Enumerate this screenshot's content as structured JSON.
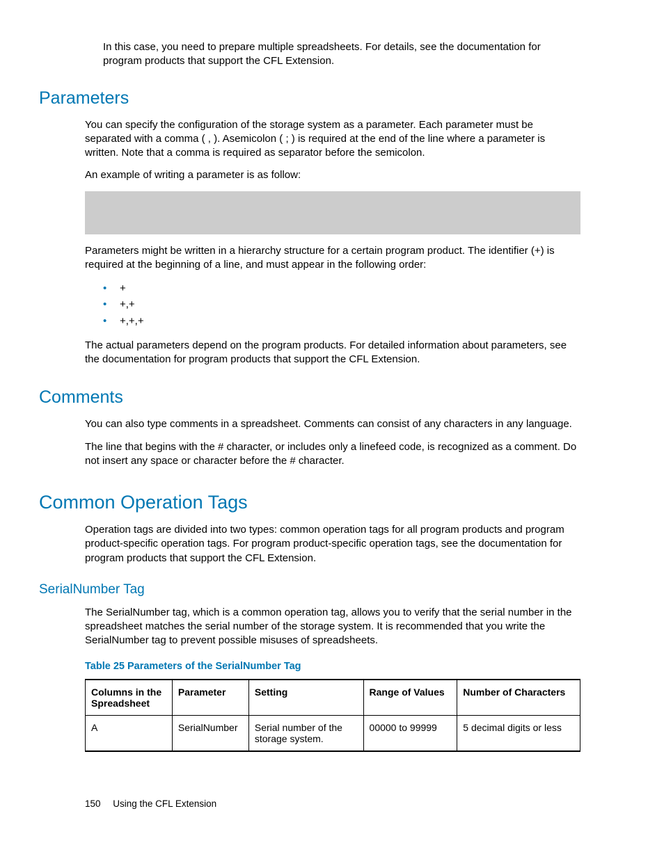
{
  "intro": "In this case, you need to prepare multiple spreadsheets. For details, see the documentation for program products that support the CFL Extension.",
  "parameters": {
    "heading": "Parameters",
    "p1": "You can specify the configuration of the storage system as a parameter. Each parameter must be separated with a comma ( , ). Asemicolon ( ; ) is required at the end of the line where a parameter is written. Note that a comma is required as separator before the semicolon.",
    "p2": "An example of writing a parameter is as follow:",
    "p3": "Parameters might be written in a hierarchy structure for a certain program product. The identifier (+) is required at the beginning of a line, and must appear in the following order:",
    "bullets": [
      "+",
      "+,+",
      "+,+,+"
    ],
    "p4": "The actual parameters depend on the program products. For detailed information about parameters, see the documentation for program products that support the CFL Extension."
  },
  "comments": {
    "heading": "Comments",
    "p1": "You can also type comments in a spreadsheet. Comments can consist of any characters in any language.",
    "p2": "The line that begins with the # character, or includes only a linefeed code, is recognized as a comment. Do not insert any space or character before the # character."
  },
  "common": {
    "heading": "Common Operation Tags",
    "p1": "Operation tags are divided into two types: common operation tags for all program products and program product-specific operation tags. For program product-specific operation tags, see the documentation for program products that support the CFL Extension."
  },
  "serial": {
    "heading": "SerialNumber Tag",
    "p1": "The SerialNumber tag, which is a common operation tag, allows you to verify that the serial number in the spreadsheet matches the serial number of the storage system. It is recommended that you write the SerialNumber tag to prevent possible misuses of spreadsheets.",
    "tablecaption": "Table 25 Parameters of the SerialNumber Tag",
    "headers": {
      "c1": "Columns in the Spreadsheet",
      "c2": "Parameter",
      "c3": "Setting",
      "c4": "Range of Values",
      "c5": "Number of Characters"
    },
    "row": {
      "c1": "A",
      "c2": "SerialNumber",
      "c3": "Serial number of the storage system.",
      "c4": "00000 to 99999",
      "c5": "5 decimal digits or less"
    }
  },
  "footer": {
    "page": "150",
    "title": "Using the CFL Extension"
  }
}
